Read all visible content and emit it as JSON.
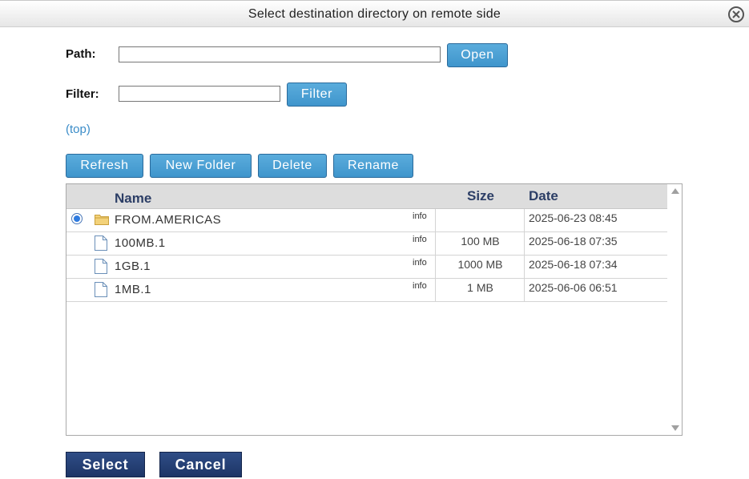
{
  "dialog": {
    "title": "Select destination directory on remote side",
    "close_icon": "close-circle-icon"
  },
  "path": {
    "label": "Path:",
    "value": "",
    "placeholder": "",
    "open_label": "Open"
  },
  "filter": {
    "label": "Filter:",
    "value": "",
    "placeholder": "",
    "filter_label": "Filter"
  },
  "breadcrumb": {
    "top_label": "(top)"
  },
  "toolbar": {
    "refresh": "Refresh",
    "new_folder": "New Folder",
    "delete": "Delete",
    "rename": "Rename"
  },
  "table": {
    "headers": {
      "name": "Name",
      "size": "Size",
      "date": "Date"
    },
    "rows": [
      {
        "type": "folder",
        "icon": "folder-icon",
        "selected": true,
        "name": "FROM.AMERICAS",
        "info": "info",
        "size": "",
        "date": "2025-06-23 08:45"
      },
      {
        "type": "file",
        "icon": "file-icon",
        "selected": false,
        "name": "100MB.1",
        "info": "info",
        "size": "100 MB",
        "date": "2025-06-18 07:35"
      },
      {
        "type": "file",
        "icon": "file-icon",
        "selected": false,
        "name": "1GB.1",
        "info": "info",
        "size": "1000 MB",
        "date": "2025-06-18 07:34"
      },
      {
        "type": "file",
        "icon": "file-icon",
        "selected": false,
        "name": "1MB.1",
        "info": "info",
        "size": "1 MB",
        "date": "2025-06-06 06:51"
      }
    ]
  },
  "footer": {
    "select_label": "Select",
    "cancel_label": "Cancel"
  },
  "colors": {
    "button_blue": "#4a9fd5",
    "button_dark": "#243f73",
    "link": "#3a8cc8",
    "header_text": "#2c3e66"
  }
}
